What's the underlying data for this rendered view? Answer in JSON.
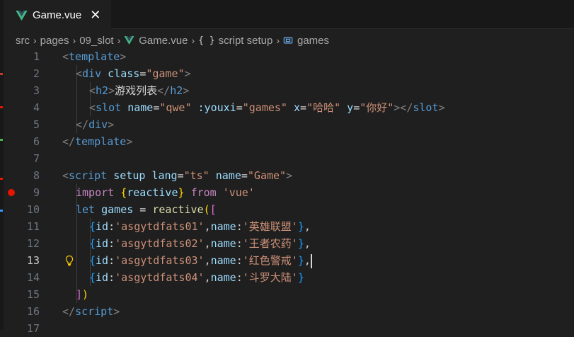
{
  "tab": {
    "label": "Game.vue",
    "close": "✕"
  },
  "breadcrumb": {
    "items": [
      "src",
      "pages",
      "09_slot",
      "Game.vue",
      "script setup",
      "games"
    ],
    "braces_glyph": "{ }",
    "separator": "›"
  },
  "editor": {
    "line_numbers": [
      "1",
      "2",
      "3",
      "4",
      "5",
      "6",
      "7",
      "8",
      "9",
      "10",
      "11",
      "12",
      "13",
      "14",
      "15",
      "16",
      "17"
    ],
    "active_line": "13",
    "lines": [
      [
        [
          "t-punc",
          "<"
        ],
        [
          "t-tag",
          "template"
        ],
        [
          "t-punc",
          ">"
        ]
      ],
      [
        [
          "t-punc",
          "<"
        ],
        [
          "t-tag",
          "div"
        ],
        [
          "t-text",
          " "
        ],
        [
          "t-attr",
          "class"
        ],
        [
          "t-eq",
          "="
        ],
        [
          "t-str",
          "\"game\""
        ],
        [
          "t-punc",
          ">"
        ]
      ],
      [
        [
          "t-punc",
          "<"
        ],
        [
          "t-tag",
          "h2"
        ],
        [
          "t-punc",
          ">"
        ],
        [
          "t-text",
          "游戏列表"
        ],
        [
          "t-punc",
          "</"
        ],
        [
          "t-tag",
          "h2"
        ],
        [
          "t-punc",
          ">"
        ]
      ],
      [
        [
          "t-punc",
          "<"
        ],
        [
          "t-tag",
          "slot"
        ],
        [
          "t-text",
          " "
        ],
        [
          "t-attr",
          "name"
        ],
        [
          "t-eq",
          "="
        ],
        [
          "t-str",
          "\"qwe\""
        ],
        [
          "t-text",
          " "
        ],
        [
          "t-attr",
          ":youxi"
        ],
        [
          "t-eq",
          "="
        ],
        [
          "t-str",
          "\"games\""
        ],
        [
          "t-text",
          " "
        ],
        [
          "t-attr",
          "x"
        ],
        [
          "t-eq",
          "="
        ],
        [
          "t-str",
          "\"哈哈\""
        ],
        [
          "t-text",
          " "
        ],
        [
          "t-attr",
          "y"
        ],
        [
          "t-eq",
          "="
        ],
        [
          "t-str",
          "\"你好\""
        ],
        [
          "t-punc",
          "></"
        ],
        [
          "t-tag",
          "slot"
        ],
        [
          "t-punc",
          ">"
        ]
      ],
      [
        [
          "t-punc",
          "</"
        ],
        [
          "t-tag",
          "div"
        ],
        [
          "t-punc",
          ">"
        ]
      ],
      [
        [
          "t-punc",
          "</"
        ],
        [
          "t-tag",
          "template"
        ],
        [
          "t-punc",
          ">"
        ]
      ],
      [],
      [
        [
          "t-punc",
          "<"
        ],
        [
          "t-tag",
          "script"
        ],
        [
          "t-text",
          " "
        ],
        [
          "t-attr",
          "setup"
        ],
        [
          "t-text",
          " "
        ],
        [
          "t-attr",
          "lang"
        ],
        [
          "t-eq",
          "="
        ],
        [
          "t-str",
          "\"ts\""
        ],
        [
          "t-text",
          " "
        ],
        [
          "t-attr",
          "name"
        ],
        [
          "t-eq",
          "="
        ],
        [
          "t-str",
          "\"Game\""
        ],
        [
          "t-punc",
          ">"
        ]
      ],
      [
        [
          "t-kw",
          "import"
        ],
        [
          "t-text",
          " "
        ],
        [
          "t-br1",
          "{"
        ],
        [
          "t-var",
          "reactive"
        ],
        [
          "t-br1",
          "}"
        ],
        [
          "t-text",
          " "
        ],
        [
          "t-kw",
          "from"
        ],
        [
          "t-text",
          " "
        ],
        [
          "t-str",
          "'vue'"
        ]
      ],
      [
        [
          "t-blue",
          "let"
        ],
        [
          "t-text",
          " "
        ],
        [
          "t-var",
          "games"
        ],
        [
          "t-text",
          " = "
        ],
        [
          "t-fn",
          "reactive"
        ],
        [
          "t-br1",
          "("
        ],
        [
          "t-br2",
          "["
        ]
      ],
      [
        [
          "t-br3",
          "{"
        ],
        [
          "t-var",
          "id"
        ],
        [
          "t-text",
          ":"
        ],
        [
          "t-str",
          "'asgytdfats01'"
        ],
        [
          "t-text",
          ","
        ],
        [
          "t-var",
          "name"
        ],
        [
          "t-text",
          ":"
        ],
        [
          "t-str",
          "'英雄联盟'"
        ],
        [
          "t-br3",
          "}"
        ],
        [
          "t-text",
          ","
        ]
      ],
      [
        [
          "t-br3",
          "{"
        ],
        [
          "t-var",
          "id"
        ],
        [
          "t-text",
          ":"
        ],
        [
          "t-str",
          "'asgytdfats02'"
        ],
        [
          "t-text",
          ","
        ],
        [
          "t-var",
          "name"
        ],
        [
          "t-text",
          ":"
        ],
        [
          "t-str",
          "'王者农药'"
        ],
        [
          "t-br3",
          "}"
        ],
        [
          "t-text",
          ","
        ]
      ],
      [
        [
          "t-br3",
          "{"
        ],
        [
          "t-var",
          "id"
        ],
        [
          "t-text",
          ":"
        ],
        [
          "t-str",
          "'asgytdfats03'"
        ],
        [
          "t-text",
          ","
        ],
        [
          "t-var",
          "name"
        ],
        [
          "t-text",
          ":"
        ],
        [
          "t-str",
          "'红色警戒'"
        ],
        [
          "t-br3",
          "}"
        ],
        [
          "t-text",
          ","
        ]
      ],
      [
        [
          "t-br3",
          "{"
        ],
        [
          "t-var",
          "id"
        ],
        [
          "t-text",
          ":"
        ],
        [
          "t-str",
          "'asgytdfats04'"
        ],
        [
          "t-text",
          ","
        ],
        [
          "t-var",
          "name"
        ],
        [
          "t-text",
          ":"
        ],
        [
          "t-str",
          "'斗罗大陆'"
        ],
        [
          "t-br3",
          "}"
        ]
      ],
      [
        [
          "t-br2",
          "]"
        ],
        [
          "t-br1",
          ")"
        ]
      ],
      [
        [
          "t-punc",
          "</"
        ],
        [
          "t-tag",
          "script"
        ],
        [
          "t-punc",
          ">"
        ]
      ],
      []
    ]
  },
  "colors": {
    "background": "#1f1f1f",
    "breakpoint": "#e51400",
    "vue_green": "#41b883",
    "vue_dark": "#35495e"
  },
  "icons": {
    "tab": "vue-icon",
    "close": "close-icon",
    "breakpoint": "breakpoint-icon",
    "lightbulb": "lightbulb-icon",
    "symbol": "symbol-variable-icon"
  }
}
